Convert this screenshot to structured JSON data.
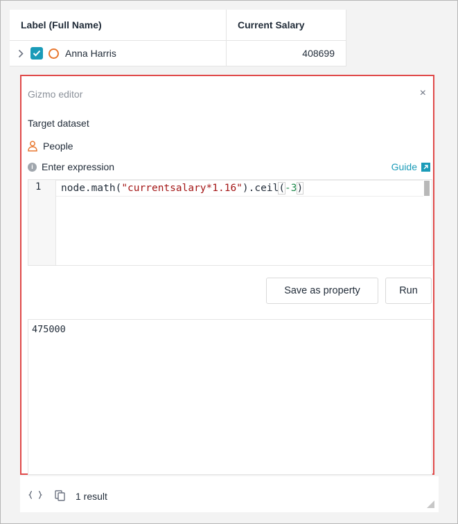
{
  "table": {
    "columns": [
      "Label (Full Name)",
      "Current Salary"
    ],
    "rows": [
      {
        "label": "Anna Harris",
        "salary": "408699"
      }
    ]
  },
  "editor": {
    "title": "Gizmo editor",
    "close_glyph": "×",
    "target_label": "Target dataset",
    "dataset_name": "People",
    "expression_label": "Enter expression",
    "guide_label": "Guide",
    "line_number": "1",
    "code": {
      "prefix": "node.math(",
      "string": "\"currentsalary*1.16\"",
      "middle": ").ceil",
      "open_paren": "(",
      "number": "-3",
      "close_paren": ")"
    },
    "save_button": "Save as property",
    "run_button": "Run",
    "result": "475000"
  },
  "footer": {
    "result_count": "1 result"
  },
  "colors": {
    "accent": "#1a9bb8",
    "highlight_border": "#e04848",
    "node_orange": "#e8772e"
  },
  "icons": [
    "chevron-right-icon",
    "checkmark-icon",
    "node-circle-icon",
    "person-icon",
    "info-icon",
    "external-link-icon",
    "json-braces-icon",
    "copy-icon",
    "resize-handle-icon"
  ]
}
